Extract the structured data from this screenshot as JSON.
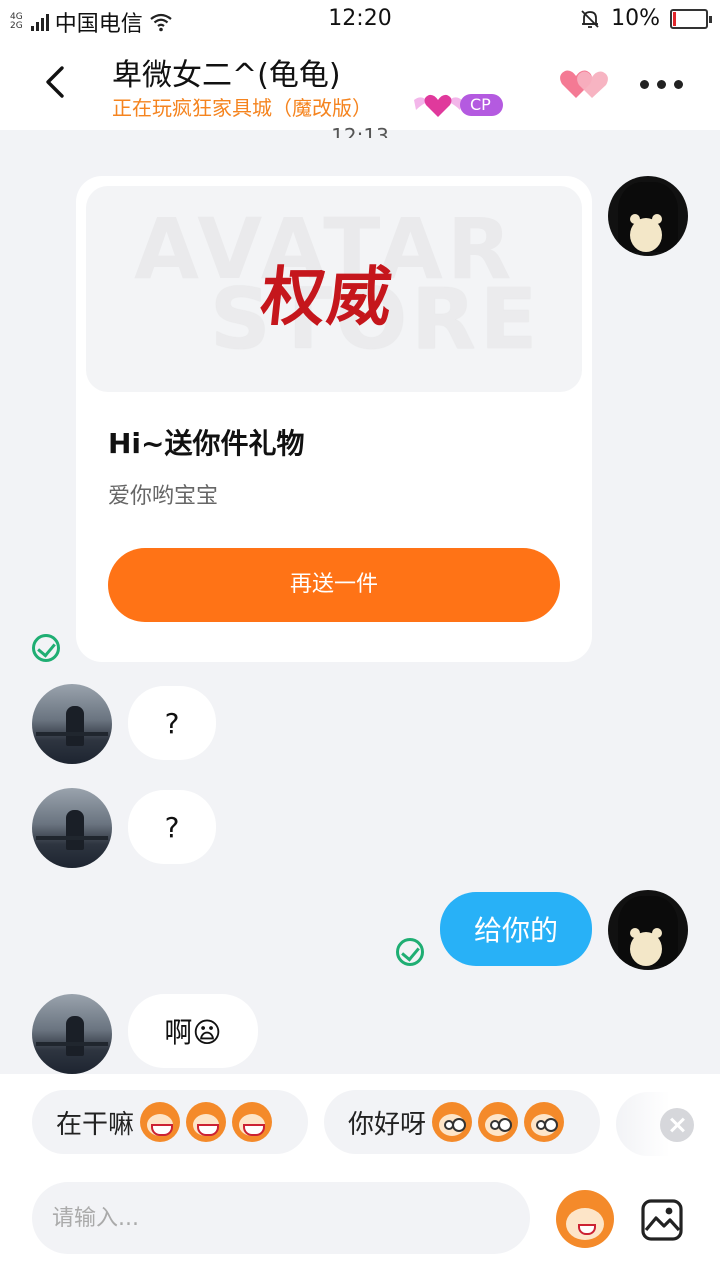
{
  "status_bar": {
    "carrier": "中国电信",
    "net_top": "4G",
    "net_bottom": "2G",
    "time": "12:20",
    "battery": "10%",
    "battery_level": 0.1,
    "battery_color": "#e0262b"
  },
  "header": {
    "title": "卑微女二^(龟龟)",
    "subtitle": "正在玩疯狂家具城（魔改版）",
    "badge": "CP",
    "accent": "#f5841f"
  },
  "chat": {
    "timestamp": "12:13",
    "gift": {
      "image_watermark_1": "AVATAR",
      "image_watermark_2": "STORE",
      "image_label": "权威",
      "title": "Hi~送你件礼物",
      "message": "爱你哟宝宝",
      "button": "再送一件",
      "button_color": "#ff7316"
    },
    "messages": [
      {
        "from": "other",
        "text": "?"
      },
      {
        "from": "other",
        "text": "?"
      },
      {
        "from": "me",
        "text": "给你的"
      },
      {
        "from": "other",
        "text": "啊😦"
      }
    ]
  },
  "quick_replies": [
    {
      "text": "在干嘛"
    },
    {
      "text": "你好呀"
    }
  ],
  "composer": {
    "placeholder": "请输入..."
  }
}
